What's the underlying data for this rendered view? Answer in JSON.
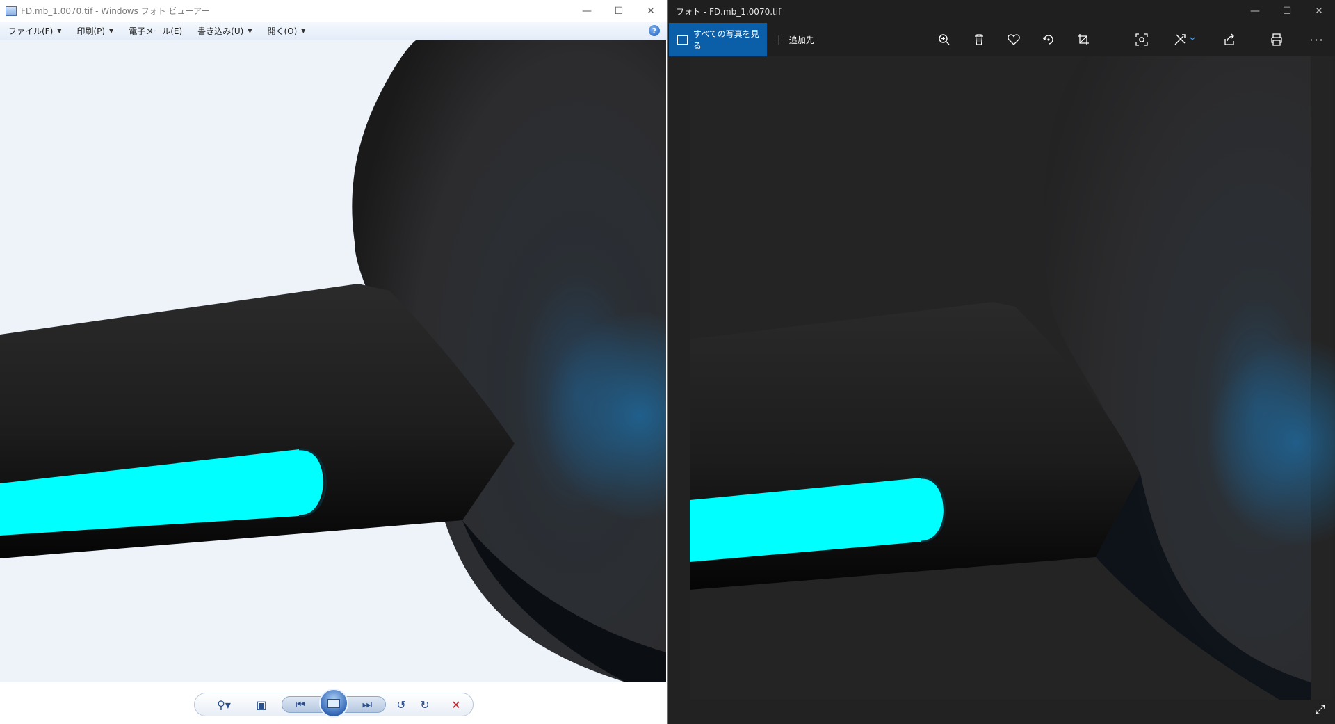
{
  "left_window": {
    "title": "FD.mb_1.0070.tif - Windows フォト ビューアー",
    "menu": [
      {
        "label": "ファイル(F)",
        "has_dropdown": true
      },
      {
        "label": "印刷(P)",
        "has_dropdown": true
      },
      {
        "label": "電子メール(E)",
        "has_dropdown": false
      },
      {
        "label": "書き込み(U)",
        "has_dropdown": true
      },
      {
        "label": "開く(O)",
        "has_dropdown": true
      }
    ],
    "help_glyph": "?",
    "toolbar_icons": [
      "zoom-icon",
      "fit-window-icon",
      "previous-icon",
      "slideshow-icon",
      "next-icon",
      "rotate-ccw-icon",
      "rotate-cw-icon",
      "delete-icon"
    ],
    "background_color": "#eef3fa"
  },
  "right_window": {
    "title": "フォト - FD.mb_1.0070.tif",
    "see_all_label": "すべての写真を見る",
    "add_label": "追加先",
    "accent_color": "#0b5ea8",
    "toolbar_icons": [
      "zoom-icon",
      "delete-icon",
      "favorite-icon",
      "rotate-icon",
      "crop-icon",
      "enhance-icon",
      "edit-icon",
      "share-icon",
      "print-icon",
      "more-icon"
    ],
    "background_color": "#222222"
  },
  "image_colors": {
    "sphere": "#2b2b2d",
    "cylinder": "#1c1c1d",
    "glow": "#00ffff",
    "highlight": "#1f5b86"
  },
  "caption_controls": [
    "minimize-icon",
    "maximize-icon",
    "close-icon"
  ]
}
